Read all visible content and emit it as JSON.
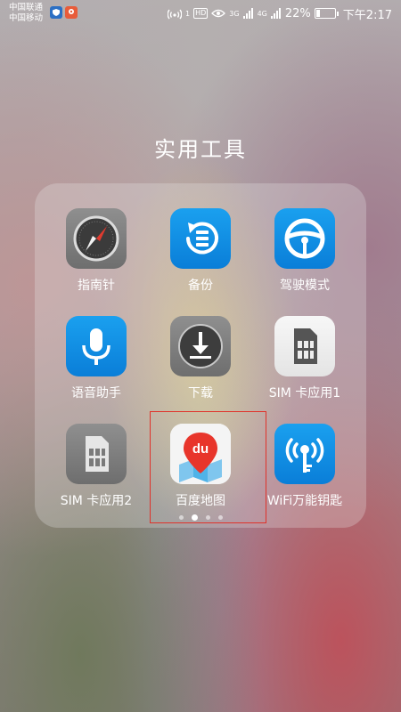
{
  "status_bar": {
    "carrier_1": "中国联通",
    "carrier_2": "中国移动",
    "network_3g": "3G",
    "network_4g": "4G",
    "hd": "HD",
    "battery_text": "22%",
    "battery_level": 0.22,
    "time": "下午2:17"
  },
  "folder": {
    "title": "实用工具",
    "apps": [
      {
        "label": "指南针",
        "icon": "compass-icon"
      },
      {
        "label": "备份",
        "icon": "backup-icon"
      },
      {
        "label": "驾驶模式",
        "icon": "steering-wheel-icon"
      },
      {
        "label": "语音助手",
        "icon": "microphone-icon"
      },
      {
        "label": "下载",
        "icon": "download-icon"
      },
      {
        "label": "SIM 卡应用1",
        "icon": "sim-card-icon"
      },
      {
        "label": "SIM 卡应用2",
        "icon": "sim-card-icon"
      },
      {
        "label": "百度地图",
        "icon": "baidu-map-icon",
        "icon_text": "du"
      },
      {
        "label": "WiFi万能钥匙",
        "icon": "wifi-key-icon"
      }
    ],
    "pages": 4,
    "current_page": 2
  },
  "colors": {
    "baidu_red": "#e8352b",
    "blue_icon": "#0a7ed8",
    "highlight": "#e0322a"
  }
}
